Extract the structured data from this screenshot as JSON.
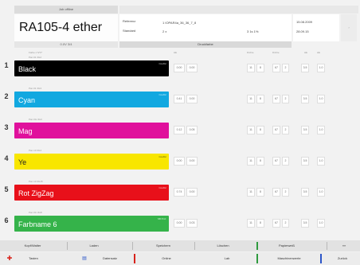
{
  "header": {
    "top_label": "Job offline",
    "title": "RA105-4 ether",
    "subtitle": "0.0V 3/4",
    "ref_label": "Referenz",
    "ref_mode": "Standard",
    "ref_file": "1  IOPAR4a_36_36_7_8",
    "ref_val_a": "2  x",
    "ref_val_b": "3  1s 1%",
    "date": "15.08.2009",
    "date_sub": "28.09.15",
    "mode_label": "Druckfarbe"
  },
  "columns": {
    "lab": "Farbe L*a*b*",
    "de_a": "ΔE",
    "de_b": "ΔE",
    "dens_a": "Dichte",
    "dens_b": "Dichte",
    "extra": "ΔE"
  },
  "inks": [
    {
      "num": "1",
      "caption": "Pan 01 3G2",
      "name": "Black",
      "tag": "CoolGr",
      "color": "#000000",
      "text": "#ffffff",
      "v1": "0.00",
      "v2": "0.00",
      "d1": "11",
      "d2": "8",
      "d3": "67",
      "d4": "2",
      "d5": "3.5",
      "d6": "1.0"
    },
    {
      "num": "2",
      "caption": "Pan 01 3G3",
      "name": "Cyan",
      "tag": "CoolGr",
      "color": "#12a8e0",
      "text": "#ffffff",
      "v1": "0.41",
      "v2": "0.00",
      "d1": "11",
      "d2": "8",
      "d3": "67",
      "d4": "2",
      "d5": "3.5",
      "d6": "1.0"
    },
    {
      "num": "3",
      "caption": "Pan 0G 3G3",
      "name": "Mag",
      "tag": "",
      "color": "#e0119c",
      "text": "#ffffff",
      "v1": "0.12",
      "v2": "0.05",
      "d1": "11",
      "d2": "8",
      "d3": "67",
      "d4": "2",
      "d5": "3.5",
      "d6": "1.0"
    },
    {
      "num": "4",
      "caption": "Pan 10 3G4",
      "name": "Ye",
      "tag": "CoolGr",
      "color": "#f8e600",
      "text": "#222222",
      "v1": "0.00",
      "v2": "0.00",
      "d1": "11",
      "d2": "8",
      "d3": "67",
      "d4": "2",
      "d5": "3.5",
      "d6": "1.0"
    },
    {
      "num": "5",
      "caption": "Pan 10 3G15",
      "name": "Rot ZigZag",
      "tag": "CoolGr",
      "color": "#e8101a",
      "text": "#ffffff",
      "v1": "0.74",
      "v2": "0.00",
      "d1": "11",
      "d2": "8",
      "d3": "67",
      "d4": "2",
      "d5": "3.5",
      "d6": "1.0"
    },
    {
      "num": "6",
      "caption": "Pan 0C 3G8",
      "name": "Farbname 6",
      "tag": "SB Prof.",
      "color": "#35b34a",
      "text": "#ffffff",
      "v1": "0.00",
      "v2": "0.03",
      "d1": "11",
      "d2": "8",
      "d3": "67",
      "d4": "2",
      "d5": "3.5",
      "d6": "1.0"
    }
  ],
  "buttons": {
    "kopf": "Kopf/Walter",
    "laden": "Laden",
    "speichern": "Speichern",
    "loeschen": "Löschen",
    "papierweiss": "Papierweiß",
    "more": "»»"
  },
  "nav": {
    "toolbar": "Tasten",
    "datensatz": "Datensatz",
    "online": "Online",
    "lab": "Lab",
    "messwerte": "Maschinenwerte",
    "zurueck": "Zurück"
  },
  "colors": {
    "accent_green": "#2e9a3e",
    "accent_red": "#d8231b",
    "accent_blue": "#2b55c8"
  }
}
